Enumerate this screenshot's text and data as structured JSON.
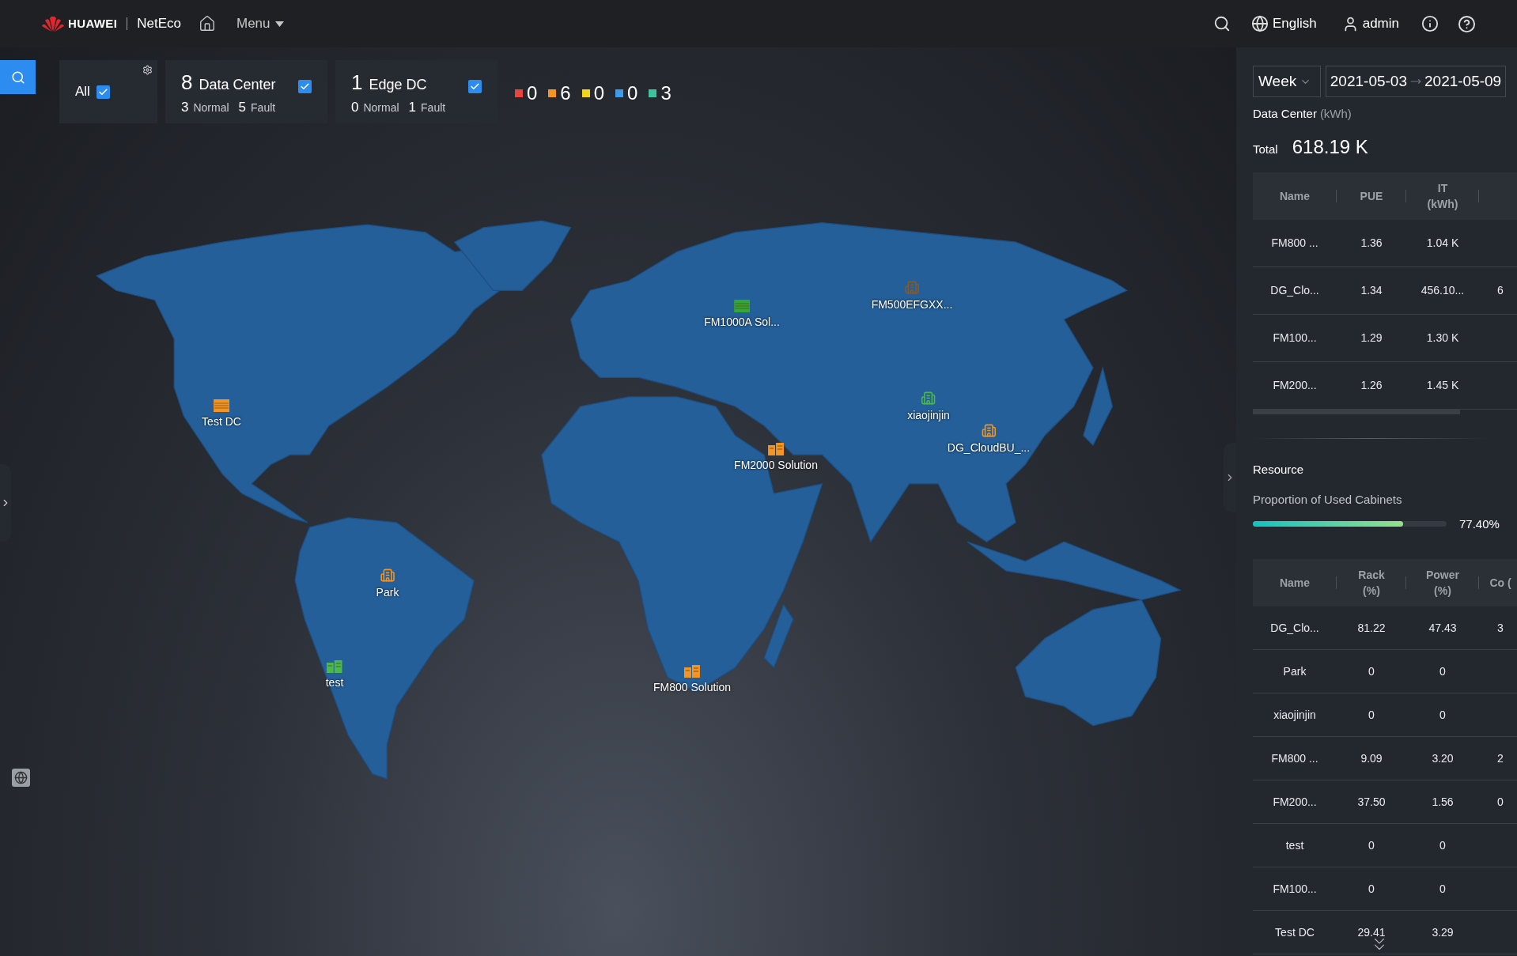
{
  "header": {
    "brand": "HUAWEI",
    "product": "NetEco",
    "menu": "Menu",
    "language": "English",
    "user": "admin"
  },
  "filters": [
    {
      "kind": "all",
      "label": "All",
      "checked": true
    },
    {
      "kind": "group",
      "count": "8",
      "label": "Data Center",
      "normal_count": "3",
      "normal_label": "Normal",
      "fault_count": "5",
      "fault_label": "Fault",
      "checked": true
    },
    {
      "kind": "group",
      "count": "1",
      "label": "Edge DC",
      "normal_count": "0",
      "normal_label": "Normal",
      "fault_count": "1",
      "fault_label": "Fault",
      "checked": true
    }
  ],
  "alarm_counts": [
    {
      "color": "#e8453c",
      "count": "0"
    },
    {
      "color": "#f39423",
      "count": "6"
    },
    {
      "color": "#f2d51b",
      "count": "0"
    },
    {
      "color": "#3d9be9",
      "count": "0"
    },
    {
      "color": "#3cc3a0",
      "count": "3"
    }
  ],
  "map_sites": [
    {
      "label": "FM1000A Sol...",
      "kind": "rack",
      "color": "#34a836"
    },
    {
      "label": "FM500EFGXX...",
      "kind": "building",
      "color": "#8a5a24"
    },
    {
      "label": "Test DC",
      "kind": "rack",
      "color": "#f39423"
    },
    {
      "label": "xiaojinjin",
      "kind": "building",
      "color": "#4cb84c"
    },
    {
      "label": "DG_CloudBU_...",
      "kind": "building",
      "color": "#f39423"
    },
    {
      "label": "FM2000 Solution",
      "kind": "cabinet",
      "color": "#f39423"
    },
    {
      "label": "Park",
      "kind": "building",
      "color": "#f39423"
    },
    {
      "label": "test",
      "kind": "cabinet",
      "color": "#4cb84c"
    },
    {
      "label": "FM800 Solution",
      "kind": "cabinet",
      "color": "#f39423"
    }
  ],
  "energy": {
    "period": "Week",
    "start_date": "2021-05-03",
    "end_date": "2021-05-09",
    "title": "Data Center",
    "unit": "(kWh)",
    "total_label": "Total",
    "total": "618.19 K",
    "columns": [
      "Name",
      "PUE",
      "IT (kWh)"
    ],
    "rows": [
      [
        "FM800 ...",
        "1.36",
        "1.04 K",
        null
      ],
      [
        "DG_Clo...",
        "1.34",
        "456.10...",
        "6"
      ],
      [
        "FM100...",
        "1.29",
        "1.30 K",
        null
      ],
      [
        "FM200...",
        "1.26",
        "1.45 K",
        null
      ]
    ]
  },
  "resource": {
    "title": "Resource",
    "proportion_label": "Proportion of Used Cabinets",
    "level": 0.774,
    "reading": "77.40%",
    "columns": [
      "Name",
      "Rack (%)",
      "Power (%)",
      "Co ("
    ],
    "rows": [
      [
        "DG_Clo...",
        "81.22",
        "47.43",
        "3"
      ],
      [
        "Park",
        "0",
        "0",
        null
      ],
      [
        "xiaojinjin",
        "0",
        "0",
        null
      ],
      [
        "FM800 ...",
        "9.09",
        "3.20",
        "2"
      ],
      [
        "FM200...",
        "37.50",
        "1.56",
        "0"
      ],
      [
        "test",
        "0",
        "0",
        null
      ],
      [
        "FM100...",
        "0",
        "0",
        null
      ],
      [
        "Test DC",
        "29.41",
        "3.29",
        null
      ]
    ]
  }
}
